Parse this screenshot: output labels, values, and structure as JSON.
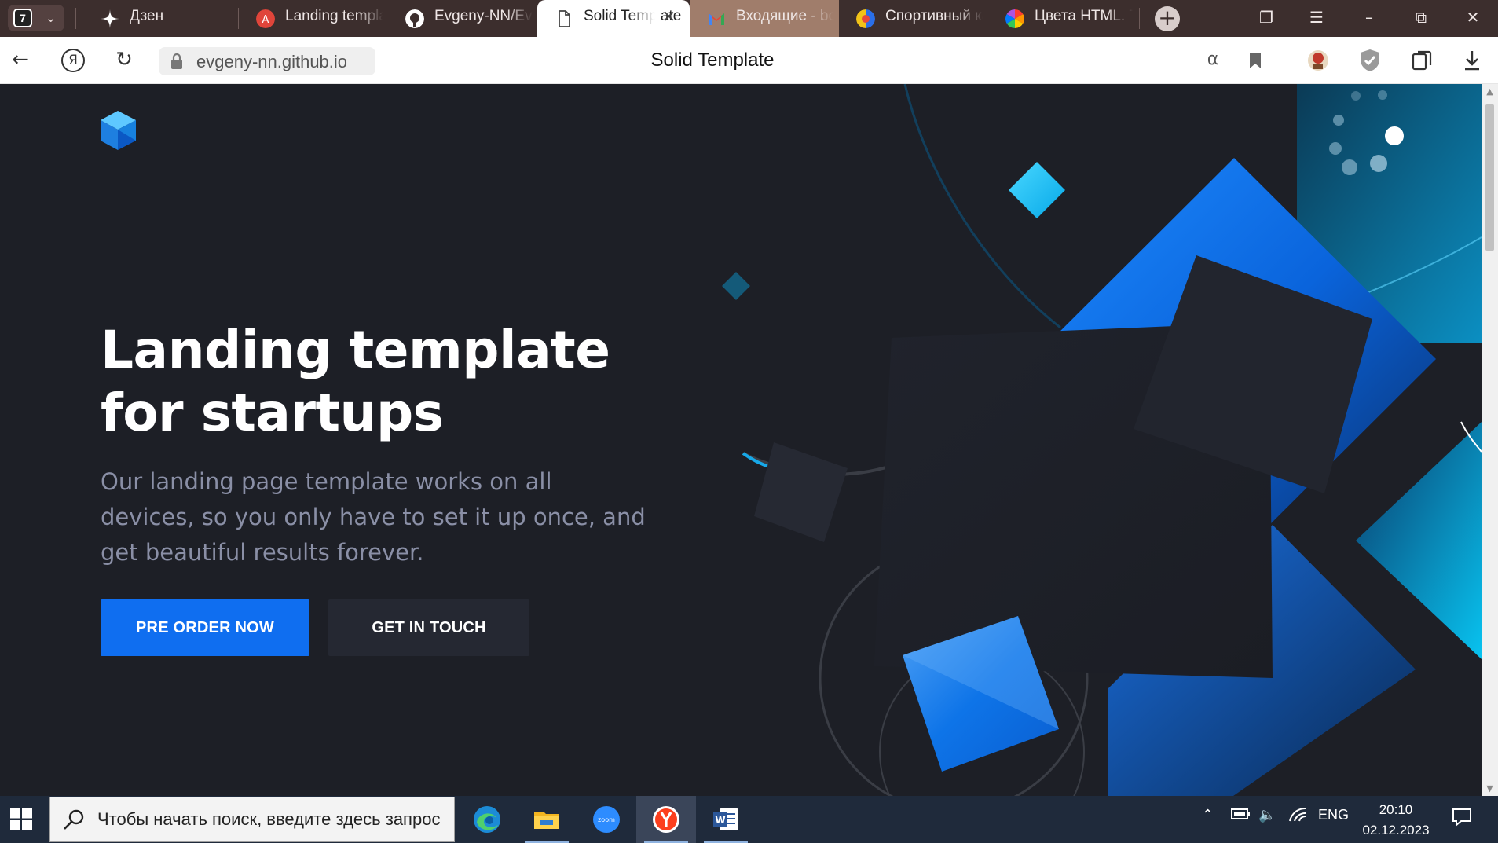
{
  "browser": {
    "tab_count": "7",
    "tabs": [
      {
        "label": "Дзен",
        "icon": "zen-icon"
      },
      {
        "label": "Landing template for startups",
        "icon": "translate-favicon"
      },
      {
        "label": "Evgeny-NN/Evgeny-NN.github.io",
        "icon": "github-icon"
      },
      {
        "label": "Solid Template",
        "icon": "page-icon",
        "active": true
      },
      {
        "label": "Входящие - box@yandex.ru",
        "icon": "gmail-icon"
      },
      {
        "label": "Спортивный канал",
        "icon": "sport-icon"
      },
      {
        "label": "Цвета HTML. Таблица",
        "icon": "color-wheel-icon"
      }
    ],
    "url": "evgeny-nn.github.io",
    "page_title": "Solid Template"
  },
  "page": {
    "hero_title": "Landing template for startups",
    "hero_subtitle": "Our landing page template works on all devices, so you only have to set it up once, and get beautiful results forever.",
    "primary_button": "PRE ORDER NOW",
    "secondary_button": "GET IN TOUCH"
  },
  "taskbar": {
    "search_placeholder": "Чтобы начать поиск, введите здесь запрос",
    "apps": [
      "edge-icon",
      "file-explorer-icon",
      "zoom-icon",
      "yandex-browser-icon",
      "word-icon"
    ],
    "language": "ENG",
    "time": "20:10",
    "date": "02.12.2023"
  },
  "colors": {
    "page_bg": "#1d1f26",
    "primary_blue": "#0f6ef0",
    "secondary_btn_bg": "#252832",
    "subtitle_text": "#8a8fa6",
    "tabbar_bg": "#3c2e2d",
    "taskbar_bg": "#1f2a3b"
  }
}
